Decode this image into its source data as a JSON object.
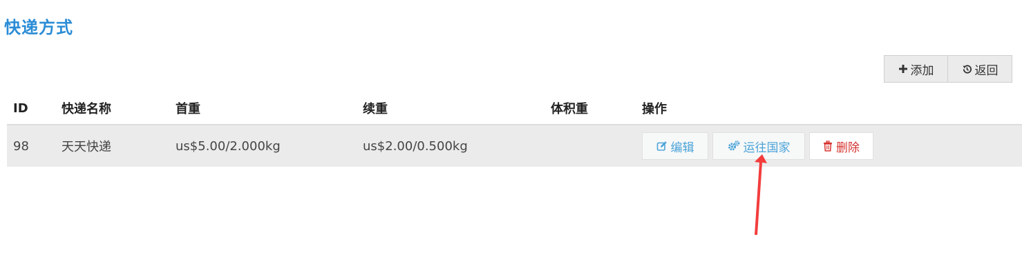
{
  "page": {
    "title": "快递方式"
  },
  "toolbar": {
    "add_label": "添加",
    "back_label": "返回"
  },
  "table": {
    "headers": {
      "id": "ID",
      "name": "快递名称",
      "first_weight": "首重",
      "continued_weight": "续重",
      "volume_weight": "体积重",
      "actions": "操作"
    },
    "rows": [
      {
        "id": "98",
        "name": "天天快递",
        "first_weight": "us$5.00/2.000kg",
        "continued_weight": "us$2.00/0.500kg",
        "volume_weight": ""
      }
    ],
    "row_actions": {
      "edit": "编辑",
      "shipping_countries": "运往国家",
      "delete": "删除"
    }
  },
  "icons": {
    "add": "plus-icon",
    "back": "history-icon",
    "edit": "edit-icon",
    "shipping_countries": "cogs-icon",
    "delete": "trash-icon",
    "annotation": "red-arrow-annotation"
  },
  "colors": {
    "title": "#2a8cd6",
    "link": "#4ba3d9",
    "danger": "#d6332f",
    "row_bg": "#ebebeb",
    "arrow": "#f33d3d"
  }
}
